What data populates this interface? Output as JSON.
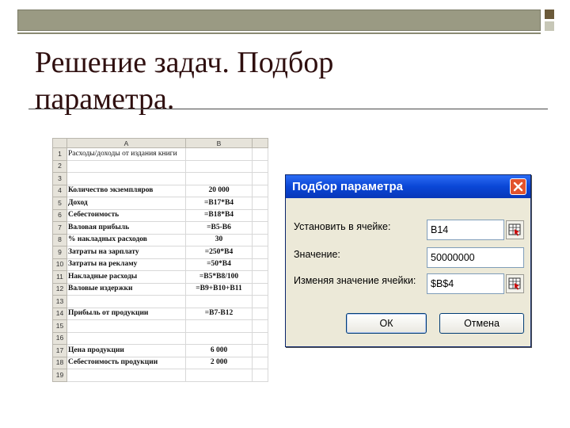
{
  "slide": {
    "title": "Решение задач. Подбор параметра."
  },
  "sheet": {
    "col_headers": [
      "A",
      "B"
    ],
    "rows": [
      {
        "n": "1",
        "a": "Расходы/доходы от издания книги",
        "b": ""
      },
      {
        "n": "2",
        "a": "",
        "b": ""
      },
      {
        "n": "3",
        "a": "",
        "b": ""
      },
      {
        "n": "4",
        "a": "Количество экземпляров",
        "b": "20 000"
      },
      {
        "n": "5",
        "a": "Доход",
        "b": "=B17*B4"
      },
      {
        "n": "6",
        "a": "Себестоимость",
        "b": "=B18*B4"
      },
      {
        "n": "7",
        "a": "Валовая прибыль",
        "b": "=B5-B6"
      },
      {
        "n": "8",
        "a": "% накладных расходов",
        "b": "30"
      },
      {
        "n": "9",
        "a": "Затраты на зарплату",
        "b": "=250*B4"
      },
      {
        "n": "10",
        "a": "Затраты на рекламу",
        "b": "=50*B4"
      },
      {
        "n": "11",
        "a": "Накладные расходы",
        "b": "=B5*B8/100"
      },
      {
        "n": "12",
        "a": "Валовые издержки",
        "b": "=B9+B10+B11"
      },
      {
        "n": "13",
        "a": "",
        "b": ""
      },
      {
        "n": "14",
        "a": "Прибыль от продукции",
        "b": "=B7-B12"
      },
      {
        "n": "15",
        "a": "",
        "b": ""
      },
      {
        "n": "16",
        "a": "",
        "b": ""
      },
      {
        "n": "17",
        "a": "Цена продукции",
        "b": "6 000"
      },
      {
        "n": "18",
        "a": "Себестоимость продукции",
        "b": "2 000"
      },
      {
        "n": "19",
        "a": "",
        "b": ""
      }
    ]
  },
  "dialog": {
    "title": "Подбор параметра",
    "set_cell_label": "Установить в ячейке:",
    "set_cell_value": "B14",
    "value_label": "Значение:",
    "value_value": "50000000",
    "changing_label": "Изменяя значение ячейки:",
    "changing_value": "$B$4",
    "ok_label": "ОК",
    "cancel_label": "Отмена"
  },
  "colors": {
    "title_text": "#2f0f0f",
    "dialog_title_bar": "#0a46d6",
    "close_button": "#e2532d",
    "dialog_body": "#ece9d8"
  },
  "icons": {
    "close": "close-icon",
    "range_select": "range-select-icon"
  }
}
